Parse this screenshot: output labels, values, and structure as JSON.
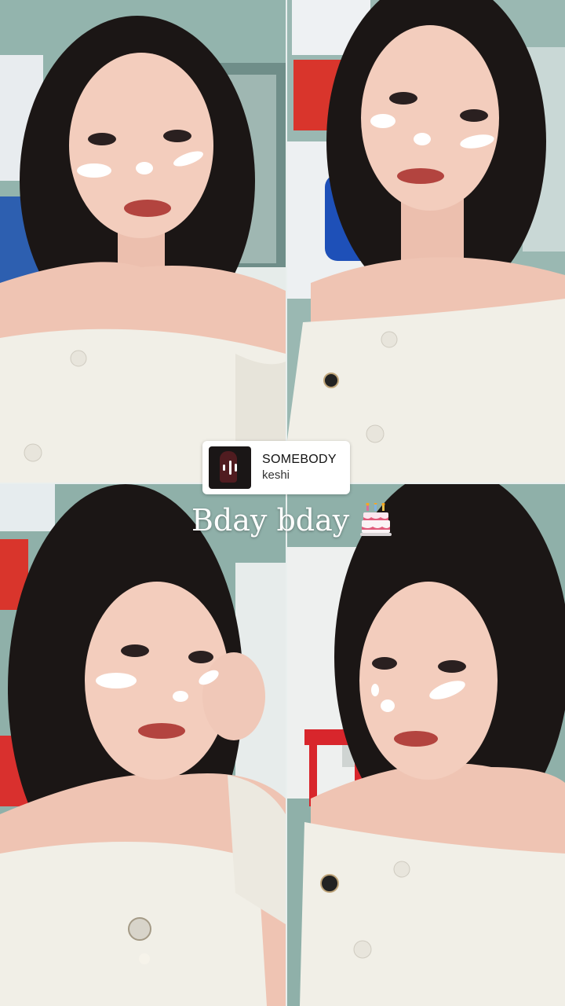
{
  "music_sticker": {
    "title": "SOMEBODY",
    "artist": "keshi"
  },
  "caption": {
    "text": "Bday bday",
    "icon": "birthday-cake-icon"
  },
  "photos": [
    {
      "icon": "selfie-photo"
    },
    {
      "icon": "selfie-photo"
    },
    {
      "icon": "selfie-photo"
    },
    {
      "icon": "selfie-photo"
    }
  ],
  "colors": {
    "wall": "#8fb3ac",
    "skin": "#f1cbbb",
    "hair": "#1b1615",
    "sweater": "#f1efe7",
    "sticker_bg": "#ffffff"
  }
}
